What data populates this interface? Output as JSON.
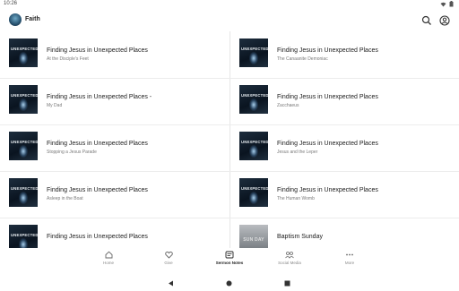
{
  "status": {
    "time": "10:26"
  },
  "app": {
    "title": "Faith"
  },
  "sermons": [
    [
      {
        "title": "Finding Jesus in Unexpected Places",
        "subtitle": "At the Disciple's Feet",
        "thumb": "UNEXPECTED"
      },
      {
        "title": "Finding Jesus in Unexpected Places",
        "subtitle": "The Canaanite Demoniac",
        "thumb": "UNEXPECTED"
      }
    ],
    [
      {
        "title": "Finding Jesus in Unexpected Places -",
        "subtitle": "My Dad",
        "thumb": "UNEXPECTED"
      },
      {
        "title": "Finding Jesus in Unexpected Places",
        "subtitle": "Zacchaeus",
        "thumb": "UNEXPECTED"
      }
    ],
    [
      {
        "title": "Finding Jesus in Unexpected Places",
        "subtitle": "Stopping a Jesus Parade",
        "thumb": "UNEXPECTED"
      },
      {
        "title": "Finding Jesus in Unexpected Places",
        "subtitle": "Jesus and the Leper",
        "thumb": "UNEXPECTED"
      }
    ],
    [
      {
        "title": "Finding Jesus in Unexpected Places",
        "subtitle": "Asleep in the Boat",
        "thumb": "UNEXPECTED"
      },
      {
        "title": "Finding Jesus in Unexpected Places",
        "subtitle": "The Human Womb",
        "thumb": "UNEXPECTED"
      }
    ],
    [
      {
        "title": "Finding Jesus in Unexpected Places",
        "subtitle": "",
        "thumb": "UNEXPECTED"
      },
      {
        "title": "Baptism Sunday",
        "subtitle": "",
        "thumb": "SUN DAY"
      }
    ]
  ],
  "nav": [
    {
      "label": "Home",
      "icon": "home-icon"
    },
    {
      "label": "Give",
      "icon": "heart-icon"
    },
    {
      "label": "Sermon Notes",
      "icon": "notes-icon",
      "active": true
    },
    {
      "label": "Social Media",
      "icon": "people-icon"
    },
    {
      "label": "More",
      "icon": "more-icon"
    }
  ],
  "colors": {
    "active": "#222222",
    "inactive": "#888888"
  }
}
